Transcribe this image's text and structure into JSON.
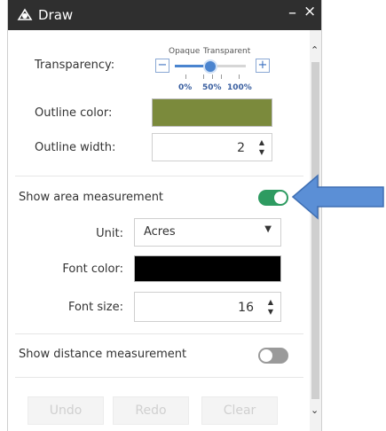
{
  "window": {
    "title": "Draw",
    "minimize_label": "–",
    "close_label": "×"
  },
  "transparency": {
    "label": "Transparency:",
    "opaque_label": "Opaque",
    "transparent_label": "Transparent",
    "ticks": [
      "0%",
      "50%",
      "100%"
    ],
    "value_percent": 50,
    "minus_label": "−",
    "plus_label": "+"
  },
  "outline_color": {
    "label": "Outline color:",
    "color": "#7b8a3c"
  },
  "outline_width": {
    "label": "Outline width:",
    "value": "2"
  },
  "area_measurement": {
    "label": "Show area measurement",
    "enabled": true,
    "toggle_color": "#2e9b61"
  },
  "unit": {
    "label": "Unit:",
    "value": "Acres"
  },
  "font_color": {
    "label": "Font color:",
    "color": "#000000"
  },
  "font_size": {
    "label": "Font size:",
    "value": "16"
  },
  "distance_measurement": {
    "label": "Show distance measurement",
    "enabled": false
  },
  "actions": {
    "undo": "Undo",
    "redo": "Redo",
    "clear": "Clear"
  },
  "annotation_arrow_color": "#5b8fd6"
}
